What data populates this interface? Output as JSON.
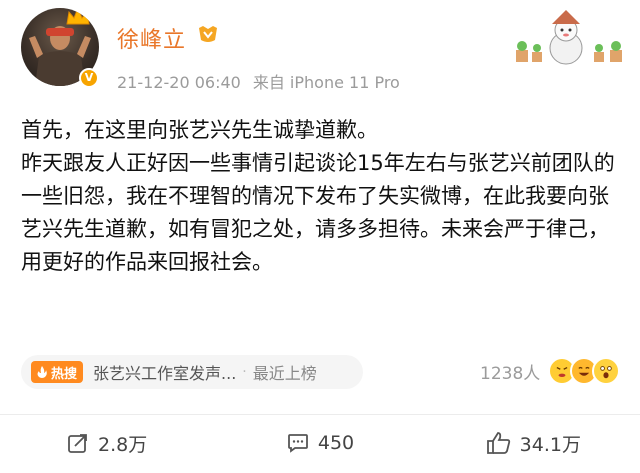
{
  "user": {
    "name": "徐峰立",
    "verified_badge": "V"
  },
  "meta": {
    "timestamp": "21-12-20 06:40",
    "device": "来自 iPhone 11 Pro"
  },
  "post": {
    "lines": [
      "首先，在这里向张艺兴先生诚挚道歉。",
      "昨天跟友人正好因一些事情引起谈论15年左右与张艺兴前团队的一些旧怨，我在不理智的情况下发布了失实微博，在此我要向张艺兴先生道歉，如有冒犯之处，请多多担待。未来会严于律己，用更好的作品来回报社会。"
    ]
  },
  "hot_search": {
    "badge": "热搜",
    "title": "张艺兴工作室发声...",
    "separator": "·",
    "subtitle": "最近上榜"
  },
  "reactions": {
    "count": "1238人"
  },
  "footer": {
    "share_count": "2.8万",
    "comment_count": "450",
    "like_count": "34.1万"
  },
  "colors": {
    "username": "#e9772a",
    "meta_gray": "#9b9b9b",
    "hot_badge": "#ff8a1f"
  },
  "icons": {
    "share": "share-icon",
    "comment": "comment-icon",
    "like": "like-icon",
    "vip": "vip-icon",
    "flame": "flame-icon"
  }
}
